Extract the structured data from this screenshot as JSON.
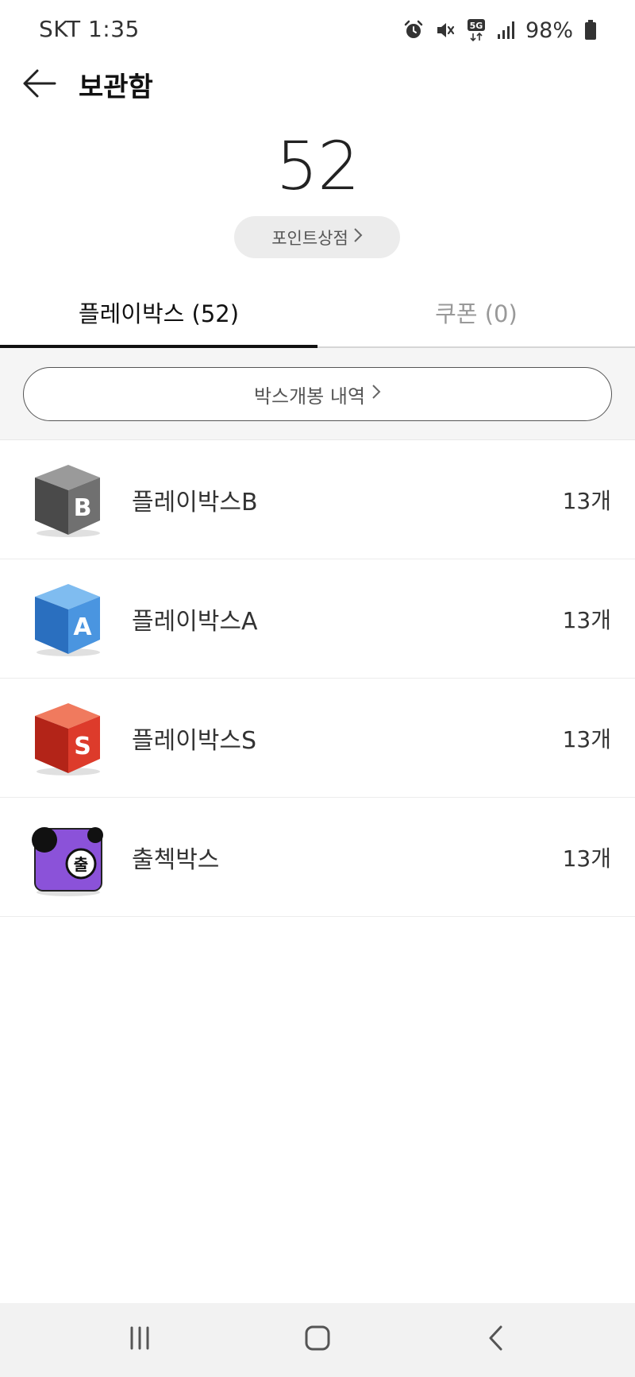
{
  "status_bar": {
    "carrier_time": "SKT 1:35",
    "battery": "98%",
    "network": "5G",
    "icons": [
      "alarm-icon",
      "mute-icon",
      "5g-icon",
      "signal-icon",
      "battery-icon"
    ]
  },
  "header": {
    "title": "보관함",
    "back_icon": "arrow-left-icon"
  },
  "points": {
    "count": "52",
    "shop_label": "포인트상점"
  },
  "tabs": [
    {
      "label": "플레이박스 (52)",
      "active": true
    },
    {
      "label": "쿠폰 (0)",
      "active": false
    }
  ],
  "history": {
    "label": "박스개봉 내역"
  },
  "boxes": [
    {
      "name": "플레이박스B",
      "count": "13개",
      "icon": "box-b-icon",
      "letter": "B",
      "color": "#6b6b6b"
    },
    {
      "name": "플레이박스A",
      "count": "13개",
      "icon": "box-a-icon",
      "letter": "A",
      "color": "#3a87d6"
    },
    {
      "name": "플레이박스S",
      "count": "13개",
      "icon": "box-s-icon",
      "letter": "S",
      "color": "#d93a2b"
    },
    {
      "name": "출첵박스",
      "count": "13개",
      "icon": "attendance-box-icon",
      "letter": "출",
      "color": "#8b52d9"
    }
  ],
  "colors": {
    "active_tab_indicator": "#111111",
    "point_shop_bg": "#ececec",
    "nav_bar_bg": "#f2f2f2"
  },
  "nav_bar": {
    "icons": [
      "recent-apps-icon",
      "home-icon",
      "back-icon"
    ]
  }
}
